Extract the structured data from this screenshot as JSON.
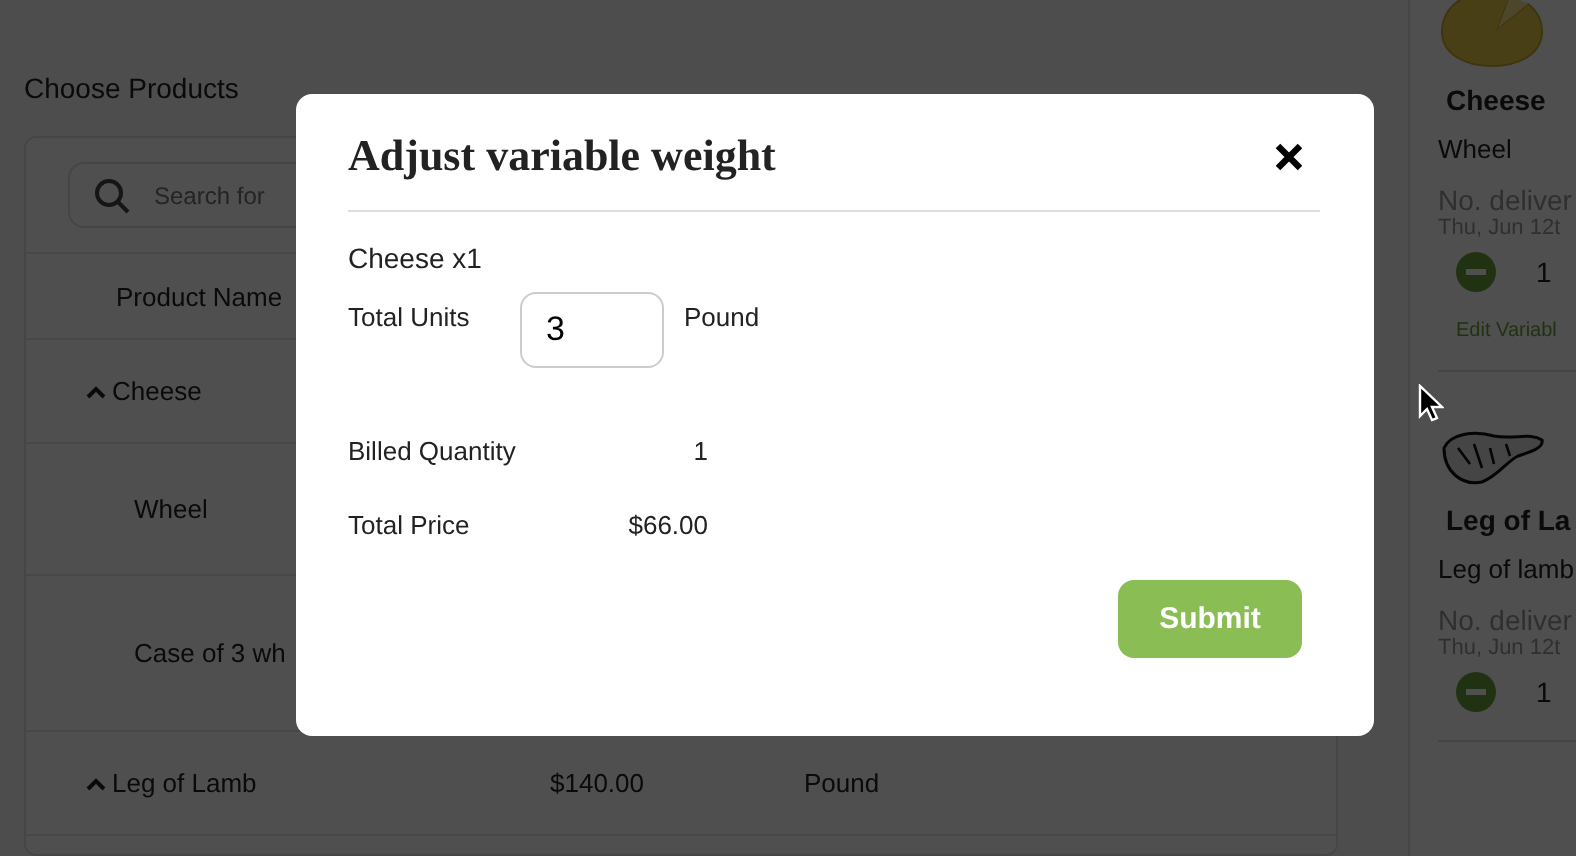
{
  "page": {
    "title": "Choose Products"
  },
  "search": {
    "placeholder": "Search for"
  },
  "table": {
    "columns": [
      "Product Name"
    ],
    "rows": [
      {
        "kind": "group",
        "name": "Cheese",
        "expanded": true
      },
      {
        "kind": "variant",
        "name": "Wheel"
      },
      {
        "kind": "variant",
        "name": "Case of 3 wh"
      },
      {
        "kind": "group",
        "name": "Leg of Lamb",
        "expanded": true,
        "price": "$140.00",
        "unit": "Pound"
      }
    ]
  },
  "cart": {
    "items": [
      {
        "kind": "cheese",
        "name": "Cheese",
        "variant": "Wheel",
        "delivery": "No. deliver",
        "date": "Thu, Jun 12t",
        "quantity": "1",
        "edit_link": "Edit Variabl"
      },
      {
        "kind": "lamb",
        "name": "Leg of La",
        "variant": "Leg of lamb",
        "delivery": "No. deliver",
        "date": "Thu, Jun 12t",
        "quantity": "1"
      }
    ]
  },
  "modal": {
    "title": "Adjust variable weight",
    "item": "Cheese x1",
    "units_label": "Total Units",
    "units_value": "3",
    "unit": "Pound",
    "billed_label": "Billed Quantity",
    "billed_value": "1",
    "price_label": "Total Price",
    "price_value": "$66.00",
    "submit": "Submit"
  }
}
